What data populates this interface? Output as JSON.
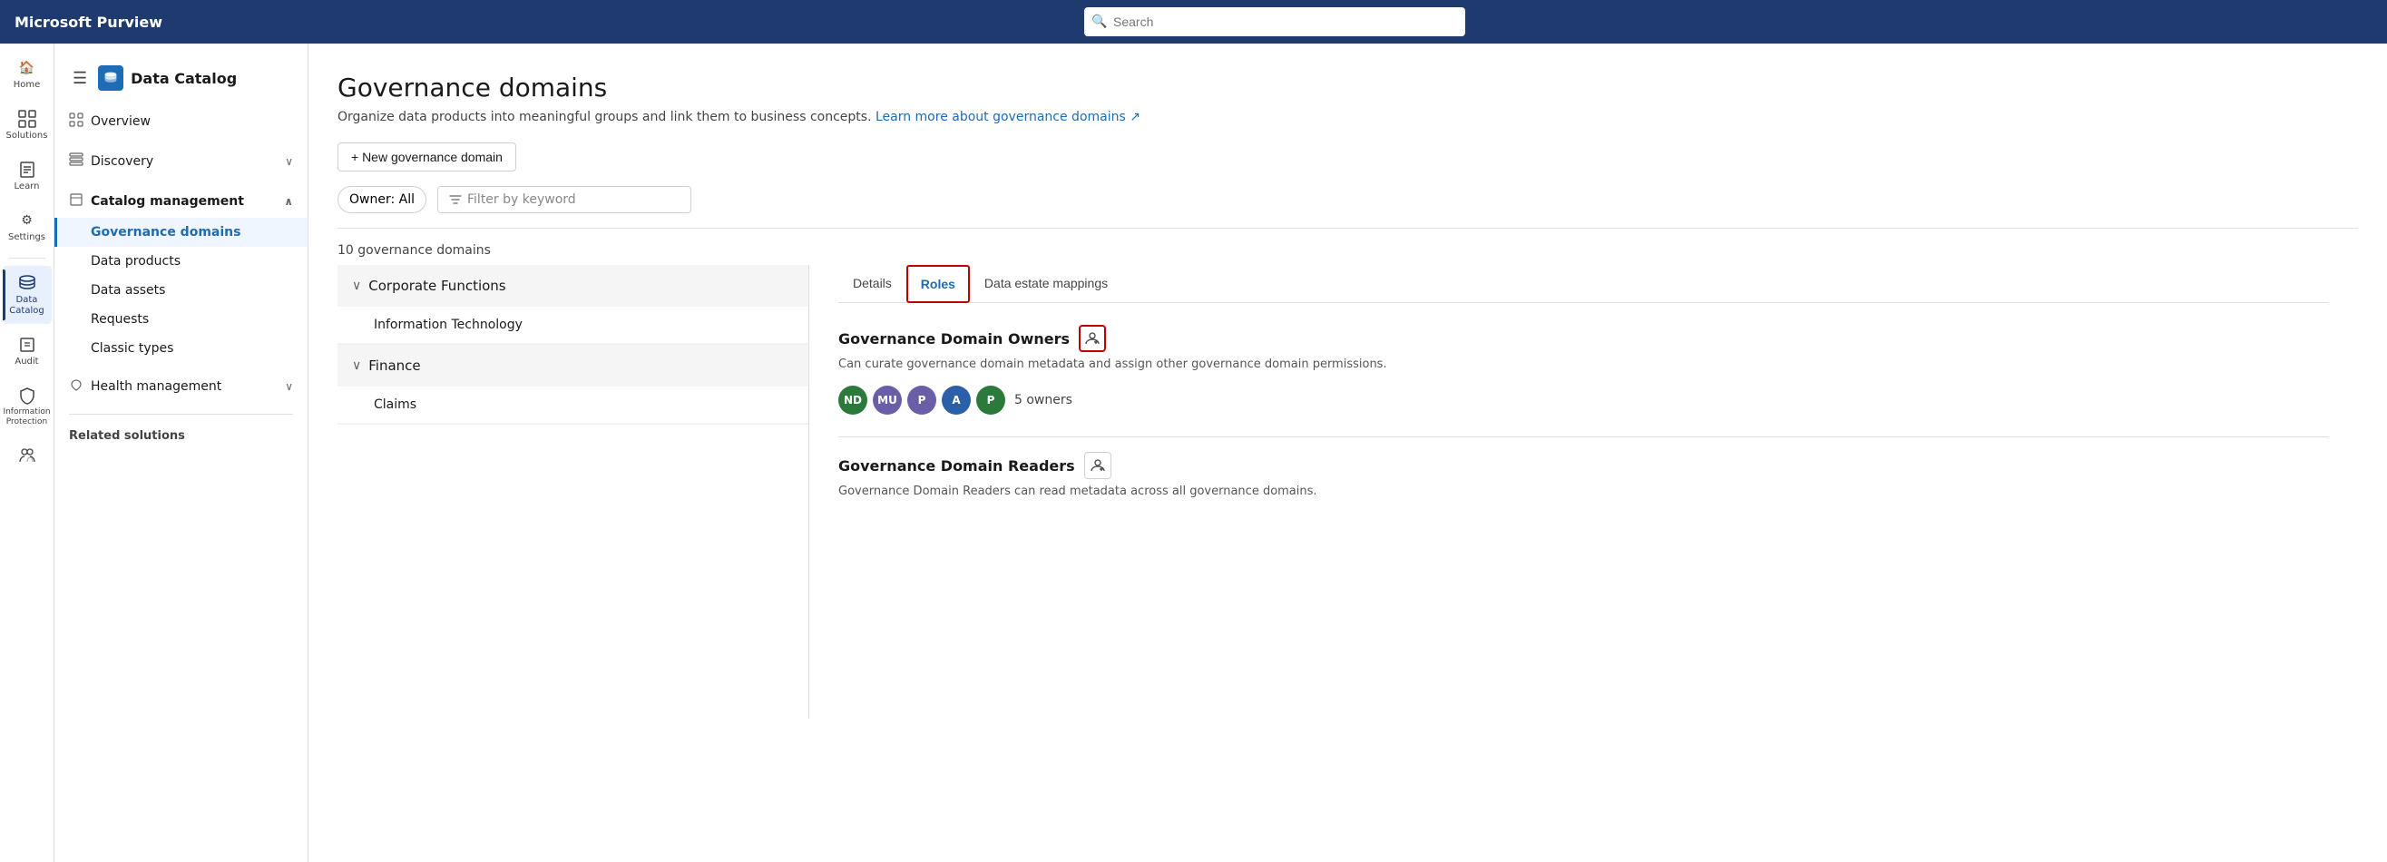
{
  "app": {
    "title": "Microsoft Purview",
    "search_placeholder": "Search"
  },
  "icon_sidebar": {
    "items": [
      {
        "id": "home",
        "label": "Home",
        "icon": "🏠"
      },
      {
        "id": "solutions",
        "label": "Solutions",
        "icon": "⊞"
      },
      {
        "id": "learn",
        "label": "Learn",
        "icon": "📖"
      },
      {
        "id": "settings",
        "label": "Settings",
        "icon": "⚙"
      },
      {
        "id": "data-catalog",
        "label": "Data Catalog",
        "icon": "🗄",
        "active": true
      },
      {
        "id": "audit",
        "label": "Audit",
        "icon": "📋"
      },
      {
        "id": "info-protection",
        "label": "Information Protection",
        "icon": "🔒"
      },
      {
        "id": "more",
        "label": "",
        "icon": "⋯"
      }
    ]
  },
  "left_panel": {
    "title": "Data Catalog",
    "icon_color": "#1e6cb5",
    "nav_items": [
      {
        "id": "overview",
        "label": "Overview",
        "icon": "⊞"
      },
      {
        "id": "discovery",
        "label": "Discovery",
        "icon": "⊟",
        "has_chevron": true
      },
      {
        "id": "catalog-mgmt",
        "label": "Catalog management",
        "icon": "📄",
        "has_chevron": true,
        "expanded": true,
        "children": [
          {
            "id": "gov-domains",
            "label": "Governance domains",
            "active": true
          },
          {
            "id": "data-products",
            "label": "Data products"
          },
          {
            "id": "data-assets",
            "label": "Data assets"
          },
          {
            "id": "requests",
            "label": "Requests"
          },
          {
            "id": "classic-types",
            "label": "Classic types"
          }
        ]
      },
      {
        "id": "health-mgmt",
        "label": "Health management",
        "icon": "❤",
        "has_chevron": true
      }
    ],
    "related_solutions": "Related solutions"
  },
  "main": {
    "page_title": "Governance domains",
    "page_desc": "Organize data products into meaningful groups and link them to business concepts.",
    "learn_more_text": "Learn more about governance domains ↗",
    "new_button_label": "+ New governance domain",
    "owner_filter_label": "Owner: All",
    "filter_placeholder": "Filter by keyword",
    "count_label": "10 governance domains",
    "domains": [
      {
        "id": "corporate-functions",
        "label": "Corporate Functions",
        "expanded": true,
        "children": [
          {
            "id": "info-technology",
            "label": "Information Technology"
          }
        ]
      },
      {
        "id": "finance",
        "label": "Finance",
        "expanded": true,
        "children": [
          {
            "id": "claims",
            "label": "Claims"
          }
        ]
      }
    ],
    "detail_panel": {
      "tabs": [
        {
          "id": "details",
          "label": "Details",
          "active": false
        },
        {
          "id": "roles",
          "label": "Roles",
          "active": true,
          "outlined": true
        },
        {
          "id": "data-estate",
          "label": "Data estate mappings",
          "active": false
        }
      ],
      "governance_owners": {
        "title": "Governance Domain Owners",
        "desc": "Can curate governance domain metadata and assign other governance domain permissions.",
        "owners": [
          {
            "initials": "ND",
            "color": "#2b7a3b"
          },
          {
            "initials": "MU",
            "color": "#6b5ea8"
          },
          {
            "initials": "P",
            "color": "#6b5ea8"
          },
          {
            "initials": "A",
            "color": "#2b5fa8"
          },
          {
            "initials": "P",
            "color": "#2b7a3b"
          }
        ],
        "count_text": "5 owners"
      },
      "governance_readers": {
        "title": "Governance Domain Readers",
        "desc": "Governance Domain Readers can read metadata across all governance domains."
      }
    }
  }
}
